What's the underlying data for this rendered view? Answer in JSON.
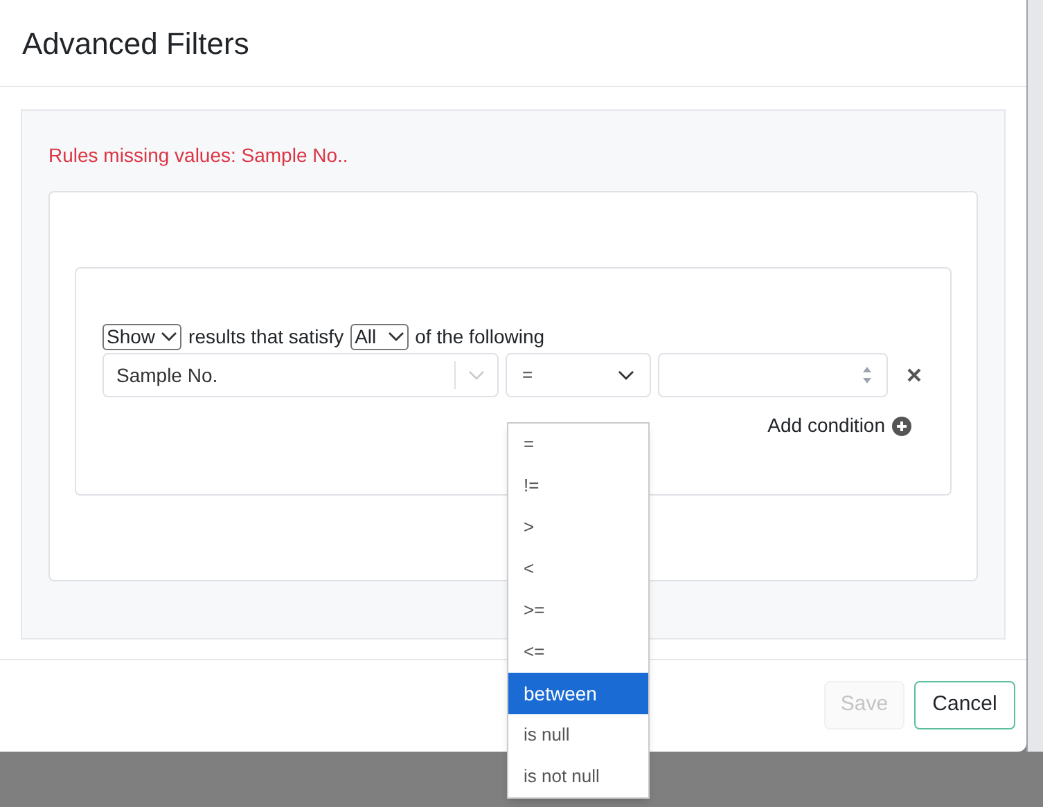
{
  "dialog": {
    "title": "Advanced Filters"
  },
  "error": "Rules missing values: Sample No..",
  "group": {
    "action": "Show",
    "text_before": "results that satisfy",
    "match": "All",
    "text_after": "of the following"
  },
  "rule": {
    "field": "Sample No.",
    "operator": "=",
    "expanded": true,
    "operator_options": [
      {
        "label": "=",
        "selected": false
      },
      {
        "label": "!=",
        "selected": false
      },
      {
        "label": ">",
        "selected": false
      },
      {
        "label": "<",
        "selected": false
      },
      {
        "label": ">=",
        "selected": false
      },
      {
        "label": "<=",
        "selected": false
      },
      {
        "label": "between",
        "selected": true
      },
      {
        "label": "is null",
        "selected": false
      },
      {
        "label": "is not null",
        "selected": false
      }
    ]
  },
  "add_condition": "Add condition",
  "buttons": [
    {
      "label": "Save",
      "kind": "save",
      "disabled": true
    },
    {
      "label": "Cancel",
      "kind": "cancel",
      "disabled": false
    }
  ]
}
